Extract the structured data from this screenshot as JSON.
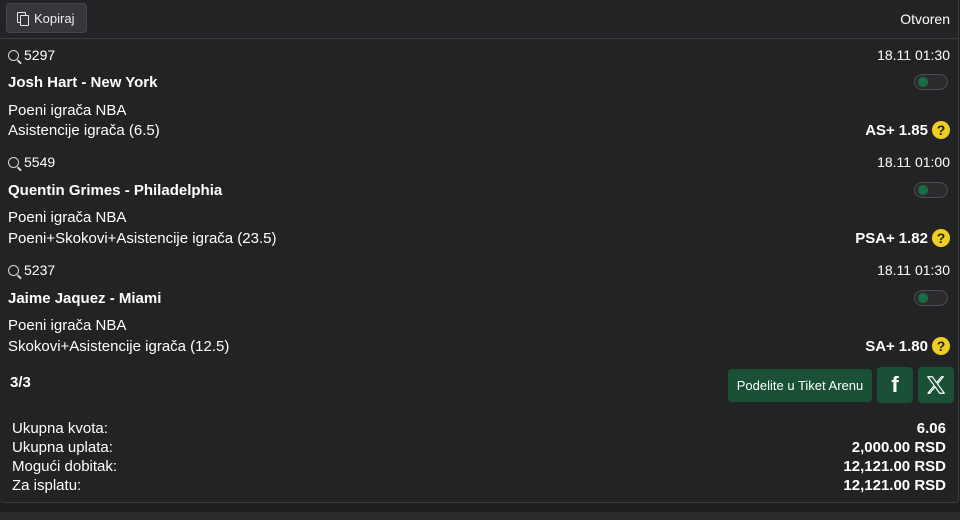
{
  "header": {
    "copy_label": "Kopiraj",
    "status": "Otvoren"
  },
  "bets": [
    {
      "code": "5297",
      "datetime": "18.11 01:30",
      "player": "Josh Hart - New York",
      "category": "Poeni igrača NBA",
      "market": "Asistencije igrača (6.5)",
      "pick": "AS+",
      "odds": "1.85"
    },
    {
      "code": "5549",
      "datetime": "18.11 01:00",
      "player": "Quentin Grimes - Philadelphia",
      "category": "Poeni igrača NBA",
      "market": "Poeni+Skokovi+Asistencije igrača (23.5)",
      "pick": "PSA+",
      "odds": "1.82"
    },
    {
      "code": "5237",
      "datetime": "18.11 01:30",
      "player": "Jaime Jaquez - Miami",
      "category": "Poeni igrača NBA",
      "market": "Skokovi+Asistencije igrača (12.5)",
      "pick": "SA+",
      "odds": "1.80"
    }
  ],
  "footer": {
    "count": "3/3",
    "share_label": "Podelite u Tiket Arenu",
    "facebook_glyph": "f"
  },
  "summary": [
    {
      "label": "Ukupna kvota:",
      "value": "6.06"
    },
    {
      "label": "Ukupna uplata:",
      "value": "2,000.00 RSD"
    },
    {
      "label": "Mogući dobitak:",
      "value": "12,121.00 RSD"
    },
    {
      "label": "Za isplatu:",
      "value": "12,121.00 RSD"
    }
  ],
  "icons": {
    "copy": "copy-icon",
    "code": "search-badge-icon",
    "help": "question-icon",
    "facebook": "facebook-icon",
    "x": "x-logo-icon"
  },
  "colors": {
    "accent_green": "#1a5034",
    "toggle_green": "#1b6b46",
    "help_yellow": "#f2cf1d"
  }
}
